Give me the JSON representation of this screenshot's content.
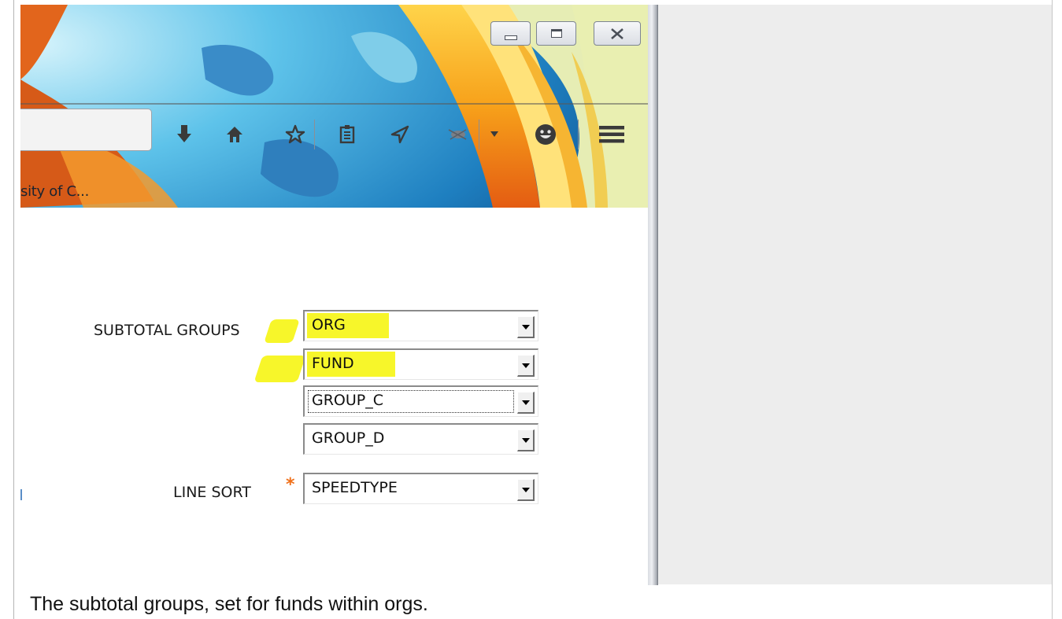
{
  "browser": {
    "tab_text": "sity of C...",
    "toolbar_icons": [
      "downloads-icon",
      "home-icon",
      "bookmark-star-icon",
      "reading-list-icon",
      "send-icon",
      "addon-bug-icon",
      "dropdown-arrow-icon",
      "smiley-icon",
      "menu-icon"
    ]
  },
  "form": {
    "subtotal_label": "SUBTOTAL GROUPS",
    "groups": [
      "ORG",
      "FUND",
      "GROUP_C",
      "GROUP_D"
    ],
    "line_sort_label": "LINE SORT",
    "required_mark": "*",
    "line_sort_value": "SPEEDTYPE"
  },
  "caption": "The subtotal groups, set for funds within orgs.",
  "colors": {
    "highlight": "#f7f62a",
    "required": "#f0701a",
    "panel_bg": "#ededed"
  }
}
